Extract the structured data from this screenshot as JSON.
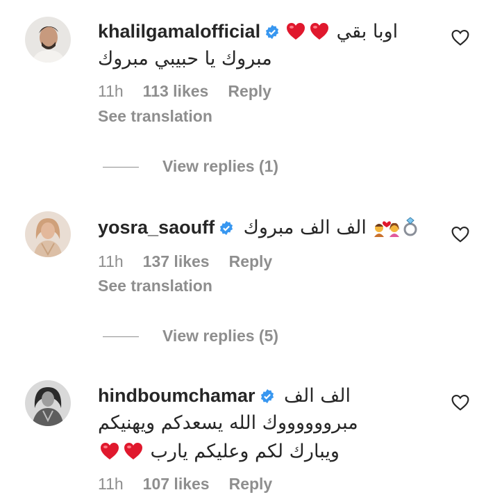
{
  "comments": [
    {
      "username": "khalilgamalofficial",
      "text_line1": "اوبا بقي",
      "text_line2": "مبروك يا حبيبي مبروك",
      "time": "11h",
      "likes": "113 likes",
      "reply": "Reply",
      "see_translation": "See translation",
      "view_replies": "View replies (1)"
    },
    {
      "username": "yosra_saouff",
      "text_line1": "الف الف مبروك",
      "time": "11h",
      "likes": "137 likes",
      "reply": "Reply",
      "see_translation": "See translation",
      "view_replies": "View replies (5)"
    },
    {
      "username": "hindboumchamar",
      "text_line1": "الف الف",
      "text_line2": "مبرووووووك الله يسعدكم ويهنيكم",
      "text_line3": "ويبارك لكم وعليكم يارب",
      "time": "11h",
      "likes": "107 likes",
      "reply": "Reply"
    }
  ],
  "colors": {
    "verified": "#3897f0",
    "heart_emoji": "#e0182d",
    "secondary_text": "#8e8e8e",
    "primary_text": "#262626"
  }
}
